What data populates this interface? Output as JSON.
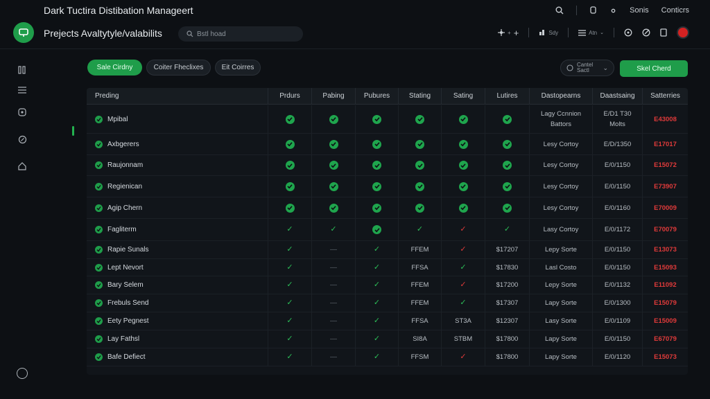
{
  "app": {
    "title": "Dark Tuctira Distibation Manageert"
  },
  "top_links": {
    "link1": "Sonis",
    "link2": "Conticrs"
  },
  "header": {
    "page_title": "Prejects Avaltytyle/valabilits",
    "search_value": "Bstl hoad",
    "view_label": "Sdy",
    "list_label": "Atn"
  },
  "pills": [
    "Sale Cirdny",
    "Coiter Fheclixes",
    "Eit Coirres"
  ],
  "filter": {
    "line1": "Cantel",
    "line2": "Sactl"
  },
  "primary_button": "Skel Cherd",
  "colors": {
    "accent": "#1f9d4a",
    "danger": "#e03a3a",
    "background": "#0d1014"
  },
  "table": {
    "columns": [
      "Preding",
      "Prdurs",
      "Pabing",
      "Pubures",
      "Stating",
      "Sating",
      "Lutires",
      "Dastopearns",
      "Daastsaing",
      "Satterries"
    ],
    "rows": [
      {
        "name": "Mpibal",
        "cells": [
          "chk",
          "chk",
          "chk",
          "chk",
          "chk",
          "chk"
        ],
        "c7": "Lagy Ccnnion\nBattors",
        "c8": "E/D1 T30\nMolts",
        "c9": "E43008"
      },
      {
        "name": "Axbgerers",
        "cells": [
          "chk",
          "chk",
          "chk",
          "chk",
          "chk",
          "chk"
        ],
        "c7": "Lesy Cortoy",
        "c8": "E/D/1350",
        "c9": "E17017"
      },
      {
        "name": "Raujonnam",
        "cells": [
          "chk",
          "chk",
          "chk",
          "chk",
          "chk",
          "chk"
        ],
        "c7": "Lesy Cortoy",
        "c8": "E/0/1150",
        "c9": "E15072"
      },
      {
        "name": "Regienican",
        "cells": [
          "chk",
          "chk",
          "chk",
          "chk",
          "chk",
          "chk"
        ],
        "c7": "Lesy Cortoy",
        "c8": "E/0/1150",
        "c9": "E73907"
      },
      {
        "name": "Agip Chern",
        "cells": [
          "chk",
          "chk",
          "chk",
          "chk",
          "chk",
          "chk"
        ],
        "c7": "Lesy Cortoy",
        "c8": "E/0/1160",
        "c9": "E70009"
      },
      {
        "name": "Fagliterm",
        "cells": [
          "tick",
          "tick",
          "chk",
          "tick",
          "x",
          "tick"
        ],
        "c7": "Lasy Cortoy",
        "c8": "E/0/1172",
        "c9": "E70079"
      },
      {
        "name": "Rapie Sunals",
        "cells": [
          "tick",
          "dash",
          "tick",
          "FFEM",
          "x",
          "$17207"
        ],
        "c7": "Lepy Sorte",
        "c8": "E/0/1150",
        "c9": "E13073"
      },
      {
        "name": "Lept Nevort",
        "cells": [
          "tick",
          "dash",
          "tick",
          "FFSA",
          "tick",
          "$17830"
        ],
        "c7": "Lasl Costo",
        "c8": "E/0/1150",
        "c9": "E15093"
      },
      {
        "name": "Bary Selem",
        "cells": [
          "tick",
          "dash",
          "tick",
          "FFEM",
          "x",
          "$17200"
        ],
        "c7": "Lepy Sorte",
        "c8": "E/0/1132",
        "c9": "E11092"
      },
      {
        "name": "Frebuls Send",
        "cells": [
          "tick",
          "dash",
          "tick",
          "FFEM",
          "tick",
          "$17307"
        ],
        "c7": "Lapy Sorte",
        "c8": "E/0/1300",
        "c9": "E15079"
      },
      {
        "name": "Eety Pegnest",
        "cells": [
          "tick",
          "dash",
          "tick",
          "FFSA",
          "ST3A",
          "$12307"
        ],
        "c7": "Lasy Sorte",
        "c8": "E/0/1109",
        "c9": "E15009"
      },
      {
        "name": "Lay Fathsl",
        "cells": [
          "tick",
          "dash",
          "tick",
          "SI8A",
          "STBM",
          "$17800"
        ],
        "c7": "Lapy Sorte",
        "c8": "E/0/1150",
        "c9": "E67079"
      },
      {
        "name": "Bafe Defiect",
        "cells": [
          "tick",
          "dash",
          "tick",
          "FFSM",
          "x",
          "$17800"
        ],
        "c7": "Lapy Sorte",
        "c8": "E/0/1120",
        "c9": "E15073"
      }
    ]
  }
}
